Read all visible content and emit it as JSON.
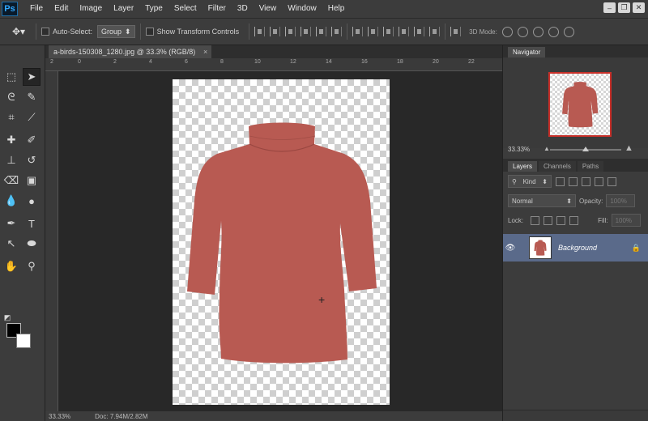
{
  "app": {
    "logo": "Ps"
  },
  "menu": [
    "File",
    "Edit",
    "Image",
    "Layer",
    "Type",
    "Select",
    "Filter",
    "3D",
    "View",
    "Window",
    "Help"
  ],
  "window_controls": {
    "minimize": "–",
    "restore": "❐",
    "close": "✕"
  },
  "options": {
    "auto_select_label": "Auto-Select:",
    "auto_select_value": "Group",
    "show_transform_label": "Show Transform Controls",
    "mode3d_label": "3D Mode:"
  },
  "document": {
    "tab_title": "a-birds-150308_1280.jpg @ 33.3% (RGB/8)",
    "close": "×",
    "ruler_ticks": [
      "2",
      "0",
      "2",
      "4",
      "6",
      "8",
      "10",
      "12",
      "14",
      "16",
      "18",
      "20",
      "22"
    ],
    "shirt_color": "#b85a52"
  },
  "status": {
    "zoom": "33.33%",
    "doc": "Doc: 7.94M/2.82M"
  },
  "navigator": {
    "tab": "Navigator",
    "zoom": "33.33%"
  },
  "layers": {
    "tabs": [
      "Layers",
      "Channels",
      "Paths"
    ],
    "kind_label": "Kind",
    "blend_mode": "Normal",
    "opacity_label": "Opacity:",
    "opacity_value": "100%",
    "lock_label": "Lock:",
    "fill_label": "Fill:",
    "fill_value": "100%",
    "items": [
      {
        "name": "Background"
      }
    ]
  },
  "colors": {
    "accent": "#31a8ff",
    "selected_layer": "#5a6a8a",
    "nav_frame": "#c8302a"
  }
}
